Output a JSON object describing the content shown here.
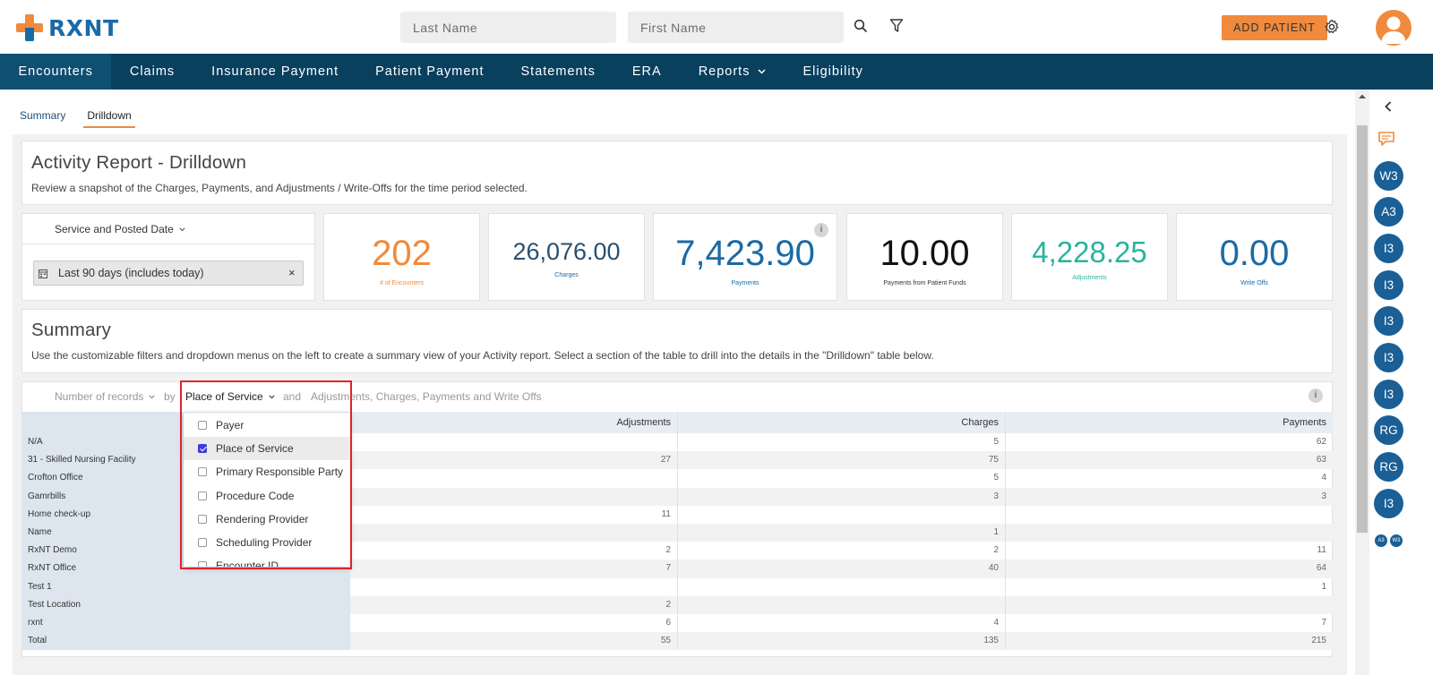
{
  "brand": {
    "name": "RXNT"
  },
  "header": {
    "last_name_placeholder": "Last Name",
    "first_name_placeholder": "First Name",
    "add_patient_label": "ADD PATIENT"
  },
  "nav": {
    "items": [
      "Encounters",
      "Claims",
      "Insurance Payment",
      "Patient Payment",
      "Statements",
      "ERA",
      "Reports",
      "Eligibility"
    ]
  },
  "subtabs": [
    "Summary",
    "Drilldown"
  ],
  "report": {
    "title": "Activity Report - Drilldown",
    "description": "Review a snapshot of the Charges, Payments, and Adjustments / Write-Offs for the time period selected.",
    "date_filter_label": "Service and Posted Date",
    "date_range": "Last 90 days (includes today)",
    "kpis": [
      {
        "value": "202",
        "label": "# of Encounters",
        "color": "#f08a3c"
      },
      {
        "value": "26,076.00",
        "label": "Charges",
        "color": "#2a4f6e"
      },
      {
        "value": "7,423.90",
        "label": "Payments",
        "color": "#1a6aa6"
      },
      {
        "value": "10.00",
        "label": "Payments from Patient Funds",
        "color": "#111111"
      },
      {
        "value": "4,228.25",
        "label": "Adjustments",
        "color": "#2ab3a0"
      },
      {
        "value": "0.00",
        "label": "Write Offs",
        "color": "#1a6aa6"
      }
    ]
  },
  "summary": {
    "title": "Summary",
    "description": "Use the customizable filters and dropdown menus on the left to create a summary view of your Activity report. Select a section of the table to drill into the details in the \"Drilldown\" table below.",
    "measure_label": "Number of records",
    "by_label": "by",
    "group_label": "Place of Service",
    "and_label": "and",
    "columns_label": "Adjustments, Charges, Payments and Write Offs"
  },
  "table": {
    "headers": [
      "",
      "Adjustments",
      "Charges",
      "Payments"
    ],
    "rows": [
      [
        "N/A",
        "",
        "5",
        "62"
      ],
      [
        "31 - Skilled Nursing Facility",
        "27",
        "75",
        "63"
      ],
      [
        "Crofton Office",
        "",
        "5",
        "4"
      ],
      [
        "Gamrbills",
        "",
        "3",
        "3"
      ],
      [
        "Home check-up",
        "11",
        "",
        ""
      ],
      [
        "Name",
        "",
        "1",
        ""
      ],
      [
        "RxNT Demo",
        "2",
        "2",
        "11"
      ],
      [
        "RxNT Office",
        "7",
        "40",
        "64"
      ],
      [
        "Test 1",
        "",
        "",
        "1"
      ],
      [
        "Test Location",
        "2",
        "",
        ""
      ],
      [
        "rxnt",
        "6",
        "4",
        "7"
      ],
      [
        "Total",
        "55",
        "135",
        "215"
      ]
    ]
  },
  "dropdown": {
    "options": [
      {
        "label": "Payer",
        "checked": false
      },
      {
        "label": "Place of Service",
        "checked": true
      },
      {
        "label": "Primary Responsible Party",
        "checked": false
      },
      {
        "label": "Procedure Code",
        "checked": false
      },
      {
        "label": "Rendering Provider",
        "checked": false
      },
      {
        "label": "Scheduling Provider",
        "checked": false
      },
      {
        "label": "Encounter ID",
        "checked": false
      }
    ]
  },
  "side_rail": {
    "badges": [
      "W3",
      "A3",
      "I3",
      "I3",
      "I3",
      "I3",
      "I3",
      "RG",
      "RG",
      "I3"
    ],
    "mini_badges": [
      "A3",
      "W3"
    ]
  }
}
